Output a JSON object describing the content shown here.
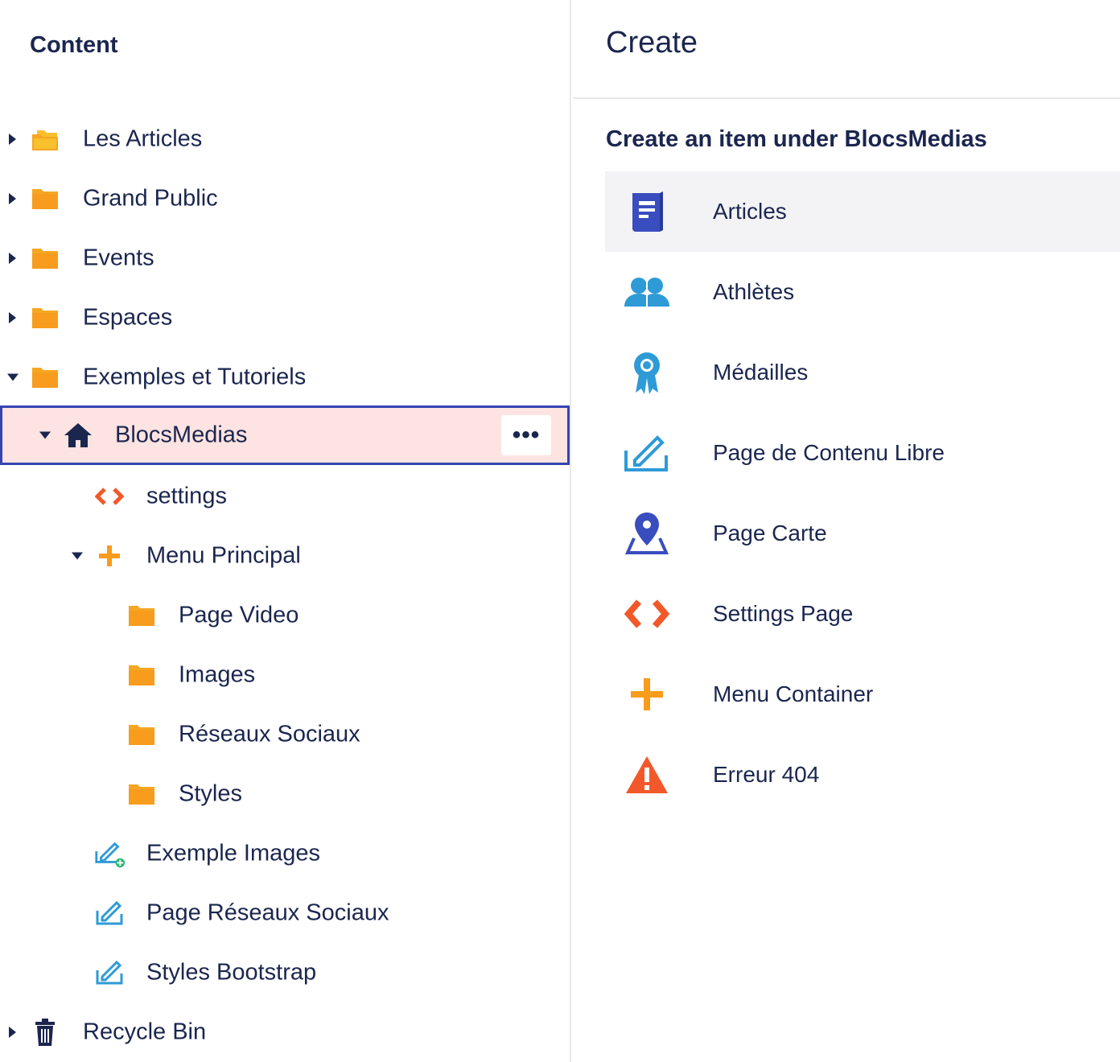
{
  "tree": {
    "title": "Content",
    "items": [
      {
        "label": "Les Articles",
        "icon": "folder-open-icon"
      },
      {
        "label": "Grand Public",
        "icon": "folder-icon"
      },
      {
        "label": "Events",
        "icon": "folder-icon"
      },
      {
        "label": "Espaces",
        "icon": "folder-icon"
      },
      {
        "label": "Exemples et Tutoriels",
        "icon": "folder-icon"
      },
      {
        "label": "BlocsMedias",
        "icon": "home-icon",
        "actions": "•••"
      },
      {
        "label": "settings",
        "icon": "code-icon"
      },
      {
        "label": "Menu Principal",
        "icon": "plus-icon"
      },
      {
        "label": "Page Video",
        "icon": "folder-icon"
      },
      {
        "label": "Images",
        "icon": "folder-icon"
      },
      {
        "label": "Réseaux Sociaux",
        "icon": "folder-icon"
      },
      {
        "label": "Styles",
        "icon": "folder-icon"
      },
      {
        "label": "Exemple Images",
        "icon": "edit-add-icon"
      },
      {
        "label": "Page Réseaux Sociaux",
        "icon": "edit-icon"
      },
      {
        "label": "Styles Bootstrap",
        "icon": "edit-icon"
      },
      {
        "label": "Recycle Bin",
        "icon": "trash-icon"
      }
    ]
  },
  "create": {
    "title": "Create",
    "subtitle": "Create an item under BlocsMedias",
    "items": [
      {
        "label": "Articles",
        "icon": "book-icon"
      },
      {
        "label": "Athlètes",
        "icon": "users-icon"
      },
      {
        "label": "Médailles",
        "icon": "medal-icon"
      },
      {
        "label": "Page de Contenu Libre",
        "icon": "edit-icon"
      },
      {
        "label": "Page Carte",
        "icon": "map-pin-icon"
      },
      {
        "label": "Settings Page",
        "icon": "code-icon"
      },
      {
        "label": "Menu Container",
        "icon": "plus-icon"
      },
      {
        "label": "Erreur 404",
        "icon": "warning-icon"
      }
    ]
  },
  "colors": {
    "text": "#1b264f",
    "folder": "#f5a623",
    "selected_bg": "#fde3e1",
    "selected_border": "#3544b1",
    "code": "#f2582a",
    "plus": "#f79c1c",
    "edit": "#2e9bd6",
    "book": "#3a4dbf",
    "users": "#2e9bd6",
    "hover_bg": "#f3f3f5"
  }
}
